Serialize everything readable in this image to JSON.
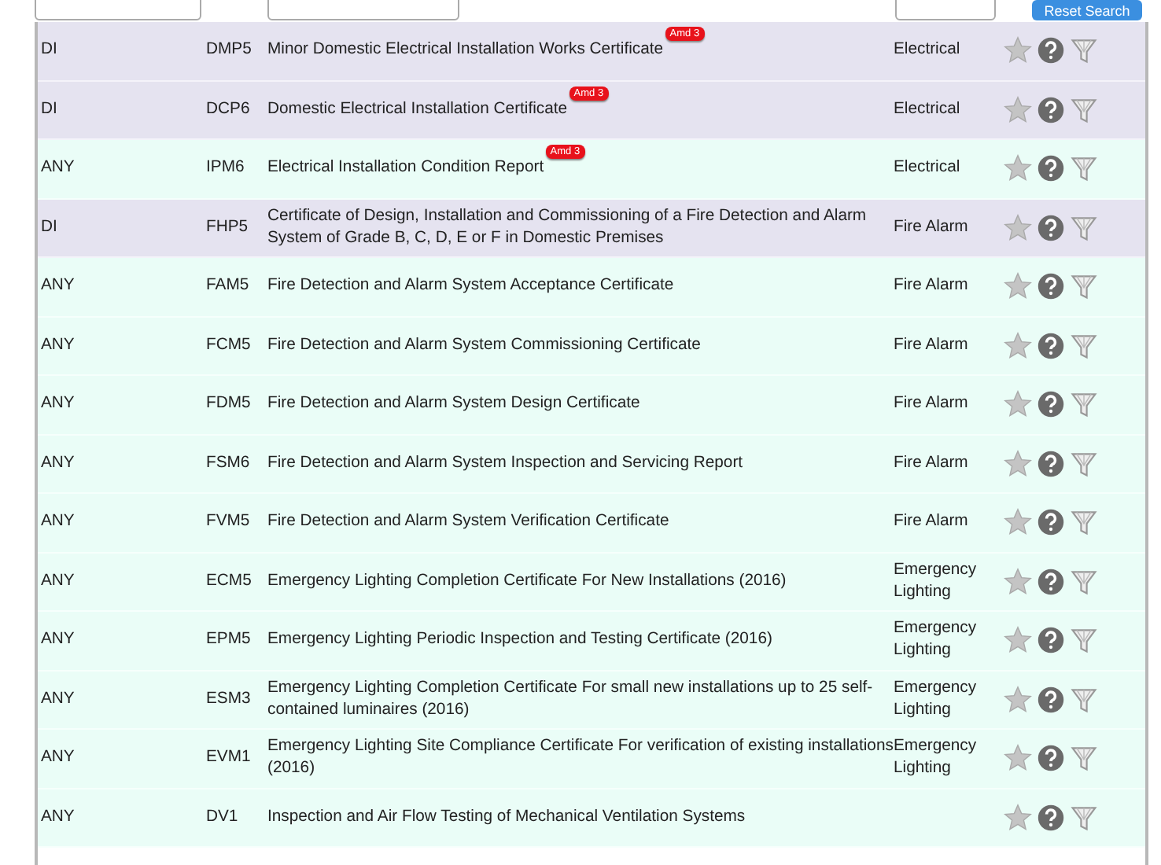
{
  "filters": {
    "reset_button": "Reset Search"
  },
  "rows": [
    {
      "scope": "DI",
      "code": "DMP5",
      "title": "Minor Domestic Electrical Installation Works Certificate",
      "badge": "Amd 3",
      "category": "Electrical",
      "highlighted": true
    },
    {
      "scope": "DI",
      "code": "DCP6",
      "title": "Domestic Electrical Installation Certificate",
      "badge": "Amd 3",
      "category": "Electrical",
      "highlighted": true
    },
    {
      "scope": "ANY",
      "code": "IPM6",
      "title": "Electrical Installation Condition Report",
      "badge": "Amd 3",
      "category": "Electrical",
      "highlighted": false
    },
    {
      "scope": "DI",
      "code": "FHP5",
      "title": "Certificate of Design, Installation and Commissioning of a Fire Detection and Alarm System of Grade B, C, D, E or F in Domestic Premises",
      "category": "Fire Alarm",
      "highlighted": true
    },
    {
      "scope": "ANY",
      "code": "FAM5",
      "title": "Fire Detection and Alarm System Acceptance Certificate",
      "category": "Fire Alarm",
      "highlighted": false
    },
    {
      "scope": "ANY",
      "code": "FCM5",
      "title": "Fire Detection and Alarm System Commissioning Certificate",
      "category": "Fire Alarm",
      "highlighted": false
    },
    {
      "scope": "ANY",
      "code": "FDM5",
      "title": "Fire Detection and Alarm System Design Certificate",
      "category": "Fire Alarm",
      "highlighted": false
    },
    {
      "scope": "ANY",
      "code": "FSM6",
      "title": "Fire Detection and Alarm System Inspection and Servicing Report",
      "category": "Fire Alarm",
      "highlighted": false
    },
    {
      "scope": "ANY",
      "code": "FVM5",
      "title": "Fire Detection and Alarm System Verification Certificate",
      "category": "Fire Alarm",
      "highlighted": false
    },
    {
      "scope": "ANY",
      "code": "ECM5",
      "title": "Emergency Lighting Completion Certificate For New Installations (2016)",
      "category": "Emergency Lighting",
      "highlighted": false
    },
    {
      "scope": "ANY",
      "code": "EPM5",
      "title": "Emergency Lighting Periodic Inspection and Testing Certificate (2016)",
      "category": "Emergency Lighting",
      "highlighted": false
    },
    {
      "scope": "ANY",
      "code": "ESM3",
      "title": "Emergency Lighting Completion Certificate For small new installations up to 25 self-contained luminaires (2016)",
      "category": "Emergency Lighting",
      "highlighted": false
    },
    {
      "scope": "ANY",
      "code": "EVM1",
      "title": "Emergency Lighting Site Compliance Certificate For verification of existing installations (2016)",
      "category": "Emergency Lighting",
      "highlighted": false
    },
    {
      "scope": "ANY",
      "code": "DV1",
      "title": "Inspection and Air Flow Testing of Mechanical Ventilation Systems",
      "highlighted": false
    }
  ]
}
